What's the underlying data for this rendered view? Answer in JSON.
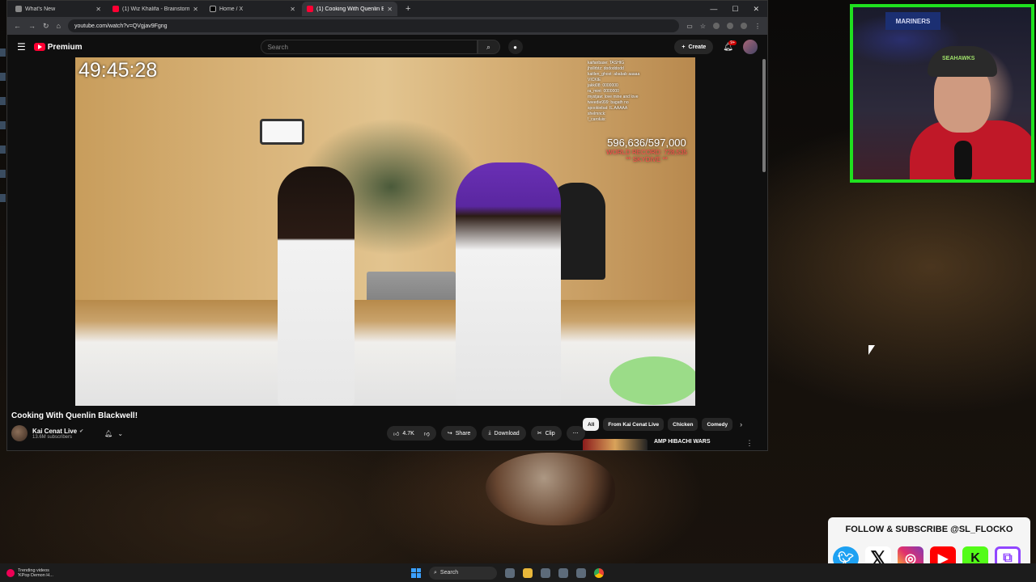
{
  "browser": {
    "tabs": [
      {
        "label": "What's New",
        "icon": "globe-icon",
        "active": false
      },
      {
        "label": "(1) Wiz Khalifa - Brainstorm",
        "icon": "youtube-icon",
        "active": false
      },
      {
        "label": "Home / X",
        "icon": "x-icon",
        "active": false
      },
      {
        "label": "(1) Cooking With Quenlin B",
        "icon": "youtube-icon",
        "active": true
      }
    ],
    "url": "youtube.com/watch?v=QVgjav9Fgng"
  },
  "youtube": {
    "logo_text": "Premium",
    "search_placeholder": "Search",
    "create_label": "Create",
    "notification_count": "9+"
  },
  "stream_overlay": {
    "timer": "49:45:28",
    "sub_count": "596,636/597,000",
    "world_record": "WORLD RECORD: 728,535",
    "goal_note": "** SKYDIVE **",
    "chat_lines": [
      "kaifanbase: TASHIG",
      "jhxllrbtz: dododdodd",
      "kaitlen_ghost: ababab aaaaa",
      "VICKIE",
      "jakki08: 0000000",
      "ra_mint: 0000000",
      "mystjaw: love mine and love",
      "tweedie999: bagath no",
      "spookiebat: IL.AAAAA",
      "shelmnck: ",
      "!_caroluis: "
    ]
  },
  "video": {
    "title": "Cooking With Quenlin Blackwell!",
    "channel": "Kai Cenat Live",
    "subscribers": "13.6M subscribers",
    "likes": "4.7K",
    "share_label": "Share",
    "download_label": "Download",
    "clip_label": "Clip"
  },
  "chips": [
    "All",
    "From Kai Cenat Live",
    "Chicken",
    "Comedy"
  ],
  "recommendation": {
    "title": "AMP HIBACHI WARS"
  },
  "webcam": {
    "sign_text": "MARINERS",
    "cap_text": "SEAHAWKS"
  },
  "social_banner": {
    "text": "FOLLOW & SUBSCRIBE @SL_FLOCKO",
    "icons": [
      "twitter-icon",
      "x-icon",
      "instagram-icon",
      "youtube-icon",
      "kick-icon",
      "twitch-icon"
    ]
  },
  "taskbar": {
    "news_title": "Trending videos",
    "news_sub": "'KPop Demon H...",
    "search_label": "Search"
  },
  "colors": {
    "accent_red": "#ff0033",
    "webcam_border": "#1fe01f"
  }
}
